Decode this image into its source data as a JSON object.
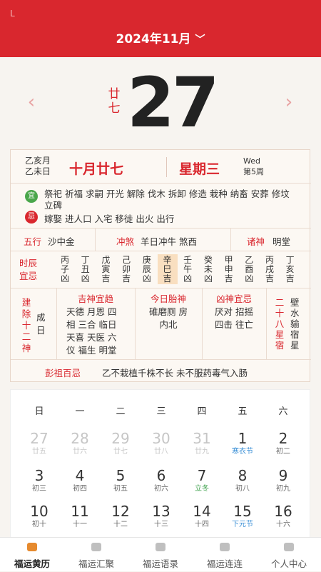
{
  "header": {
    "corner": "L",
    "month": "2024年11月",
    "chevron": "﹀"
  },
  "date": {
    "lunar_day_vertical": [
      "廿",
      "七"
    ],
    "day": "27",
    "prev": "‹",
    "next": "›"
  },
  "info": {
    "ganzhi_month": "乙亥月",
    "ganzhi_day": "乙未日",
    "lunar_date": "十月廿七",
    "weekday": "星期三",
    "weekday_en": "Wed",
    "week_no": "第5周",
    "yi_label": "宜",
    "yi": "祭祀 祈福 求嗣 开光 解除 伐木 拆卸 修造 栽种 纳畜 安葬 修坟 立碑",
    "ji_label": "忌",
    "ji": "嫁娶 进人口 入宅 移徙 出火 出行",
    "wuxing_label": "五行",
    "wuxing": "沙中金",
    "chongsha_label": "冲煞",
    "chongsha": "羊日冲牛 煞西",
    "zhushen_label": "诸神",
    "zhushen": "明堂",
    "shichen_label_1": "时辰",
    "shichen_label_2": "宜忌",
    "hours": [
      {
        "g": "丙",
        "z": "子",
        "r": "凶"
      },
      {
        "g": "丁",
        "z": "丑",
        "r": "凶"
      },
      {
        "g": "戊",
        "z": "寅",
        "r": "吉"
      },
      {
        "g": "己",
        "z": "卯",
        "r": "吉"
      },
      {
        "g": "庚",
        "z": "辰",
        "r": "凶"
      },
      {
        "g": "辛",
        "z": "巳",
        "r": "吉"
      },
      {
        "g": "壬",
        "z": "午",
        "r": "凶"
      },
      {
        "g": "癸",
        "z": "未",
        "r": "凶"
      },
      {
        "g": "甲",
        "z": "申",
        "r": "吉"
      },
      {
        "g": "乙",
        "z": "酉",
        "r": "凶"
      },
      {
        "g": "丙",
        "z": "戌",
        "r": "吉"
      },
      {
        "g": "丁",
        "z": "亥",
        "r": "吉"
      }
    ],
    "jianchu": [
      "建",
      "除",
      "十",
      "二",
      "神"
    ],
    "jianchu_value": [
      "成",
      "日"
    ],
    "jishen_title": "吉神宜趋",
    "jishen": [
      "天德 月恩 四",
      "相 三合 临日",
      "天喜 天医 六",
      "仪 福生 明堂"
    ],
    "taishen_title": "今日胎神",
    "taishen": [
      "碓磨厕 房",
      "内北"
    ],
    "xiongshen_title": "凶神宜忌",
    "xiongshen": [
      "厌对 招摇",
      "四击 往亡"
    ],
    "xiu_label": [
      "二",
      "十",
      "八",
      "星",
      "宿"
    ],
    "xiu": [
      "壁",
      "水",
      "貐",
      "宿",
      "星"
    ],
    "pengzu_label": "彭祖百忌",
    "pengzu": "乙不栽植千株不长 未不服药毒气入肠"
  },
  "calendar": {
    "weekdays": [
      "日",
      "一",
      "二",
      "三",
      "四",
      "五",
      "六"
    ],
    "days": [
      {
        "n": "27",
        "s": "廿五",
        "dim": true
      },
      {
        "n": "28",
        "s": "廿六",
        "dim": true
      },
      {
        "n": "29",
        "s": "廿七",
        "dim": true
      },
      {
        "n": "30",
        "s": "廿八",
        "dim": true
      },
      {
        "n": "31",
        "s": "廿九",
        "dim": true
      },
      {
        "n": "1",
        "s": "寒衣节",
        "type": "fest"
      },
      {
        "n": "2",
        "s": "初二"
      },
      {
        "n": "3",
        "s": "初三"
      },
      {
        "n": "4",
        "s": "初四"
      },
      {
        "n": "5",
        "s": "初五"
      },
      {
        "n": "6",
        "s": "初六"
      },
      {
        "n": "7",
        "s": "立冬",
        "type": "term"
      },
      {
        "n": "8",
        "s": "初八"
      },
      {
        "n": "9",
        "s": "初九"
      },
      {
        "n": "10",
        "s": "初十"
      },
      {
        "n": "11",
        "s": "十一"
      },
      {
        "n": "12",
        "s": "十二"
      },
      {
        "n": "13",
        "s": "十三"
      },
      {
        "n": "14",
        "s": "十四"
      },
      {
        "n": "15",
        "s": "下元节",
        "type": "fest"
      },
      {
        "n": "16",
        "s": "十六"
      }
    ]
  },
  "tabs": [
    {
      "label": "福运黄历",
      "icon": "calendar-icon",
      "active": true
    },
    {
      "label": "福运汇聚",
      "icon": "gather-icon"
    },
    {
      "label": "福运语录",
      "icon": "quote-icon"
    },
    {
      "label": "福运连连",
      "icon": "link-icon"
    },
    {
      "label": "个人中心",
      "icon": "user-icon"
    }
  ],
  "colors": {
    "brand_red": "#d9272e",
    "yi_green": "#4aa64b",
    "highlight": "#f9dfc0",
    "active_tab": "#e68a2e"
  }
}
